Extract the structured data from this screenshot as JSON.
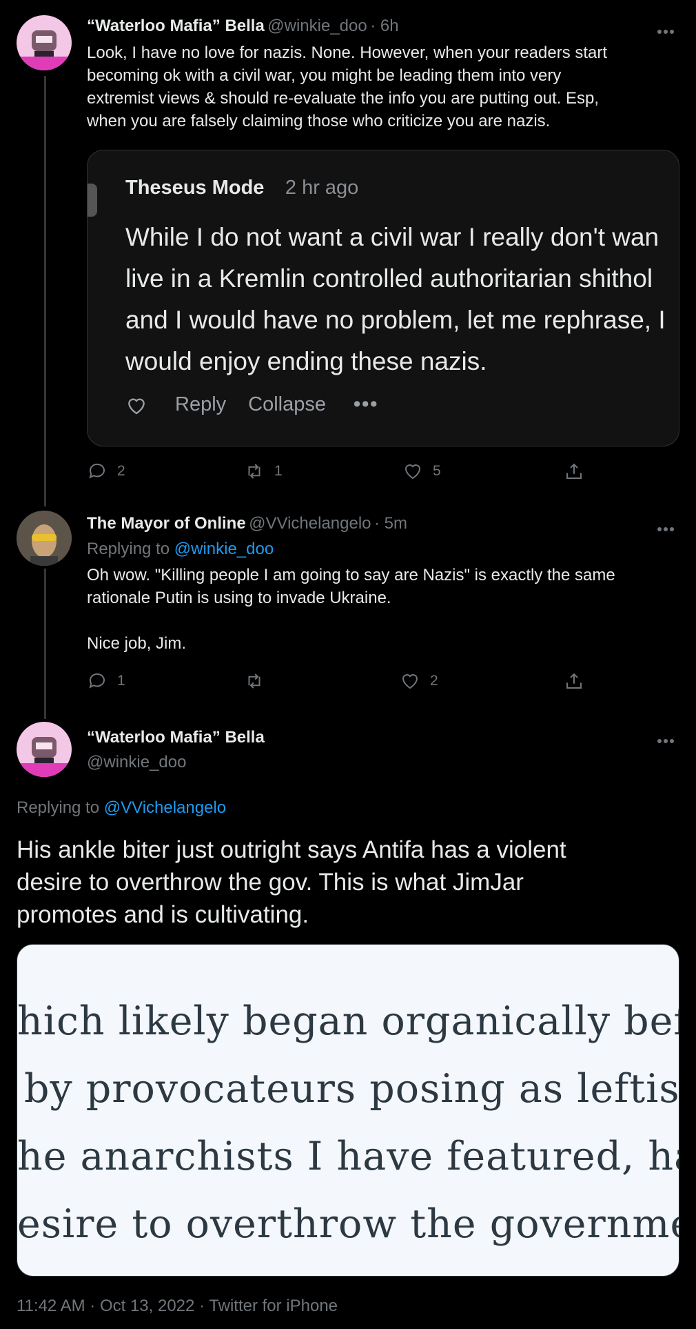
{
  "tweet1": {
    "name": "“Waterloo Mafia” Bella",
    "handle": "@winkie_doo",
    "time": "· 6h",
    "text_lines": [
      "Look, I have no love for nazis. None. However, when your readers start",
      "becoming ok with a civil war, you might be leading them into very",
      "extremist views & should re-evaluate the info you are putting out. Esp,",
      "when you are falsely claiming those who criticize you are nazis."
    ],
    "quote": {
      "author": "Theseus Mode",
      "time": "2 hr ago",
      "lines": [
        "While I do not want a civil war I really don't wan",
        "live in a Kremlin controlled authoritarian shithol",
        "and I would have no problem, let me rephrase, I",
        "would enjoy ending these nazis."
      ],
      "reply_label": "Reply",
      "collapse_label": "Collapse"
    },
    "counts": {
      "replies": "2",
      "retweets": "1",
      "likes": "5"
    }
  },
  "tweet2": {
    "name": "The Mayor of Online",
    "handle": "@VVichelangelo",
    "time": "· 5m",
    "replying_label": "Replying to",
    "replying_to": "@winkie_doo",
    "text_lines": [
      "Oh wow. \"Killing people I am going to say are Nazis\" is exactly the same",
      "rationale Putin is using to invade Ukraine."
    ],
    "text_line3": "Nice job, Jim.",
    "counts": {
      "replies": "1",
      "retweets": "",
      "likes": "2"
    }
  },
  "tweet3": {
    "name": "“Waterloo Mafia” Bella",
    "handle": "@winkie_doo",
    "replying_label": "Replying to",
    "replying_to": "@VVichelangelo",
    "text_lines": [
      "His ankle biter just outright says Antifa has a violent",
      "desire to overthrow the gov. This is what JimJar",
      "promotes and is cultivating."
    ],
    "image_lines": [
      "hich likely began organically befor",
      "by provocateurs posing as leftists,",
      "he anarchists I have featured, has t",
      "esire to overthrow the government."
    ],
    "timestamp": "11:42 AM · Oct 13, 2022 · Twitter for iPhone"
  }
}
